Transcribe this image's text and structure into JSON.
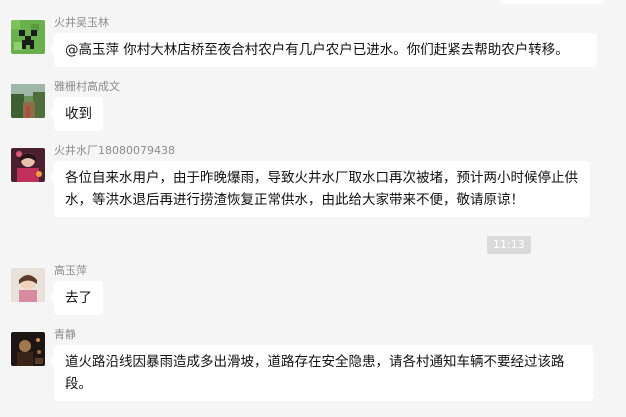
{
  "messages": [
    {
      "sender": "火井吴玉林",
      "text": "@高玉萍 你村大林店桥至夜合村农户有几户农户已进水。你们赶紧去帮助农户转移。",
      "avatar": "creeper-avatar"
    },
    {
      "sender": "雅栅村高成文",
      "text": "收到",
      "avatar": "landscape-avatar"
    },
    {
      "sender": "火井水厂18080079438",
      "text": "各位自来水用户，由于昨晚爆雨，导致火井水厂取水口再次被堵，预计两小时候停止供水，等洪水退后再进行捞渣恢复正常供水，由此给大家带来不便，敬请原谅！",
      "avatar": "person-avatar"
    },
    {
      "sender": "高玉萍",
      "text": "去了",
      "avatar": "child-avatar"
    },
    {
      "sender": "青静",
      "text": "道火路沿线因暴雨造成多出滑坡，道路存在安全隐患，请各村通知车辆不要经过该路段。",
      "avatar": "dark-photo-avatar"
    }
  ],
  "timestamp": "11:13",
  "colors": {
    "background": "#f5f5f5",
    "bubble": "#ffffff",
    "sender_name": "#8c8c8c",
    "timestamp_bg": "#dadada"
  }
}
